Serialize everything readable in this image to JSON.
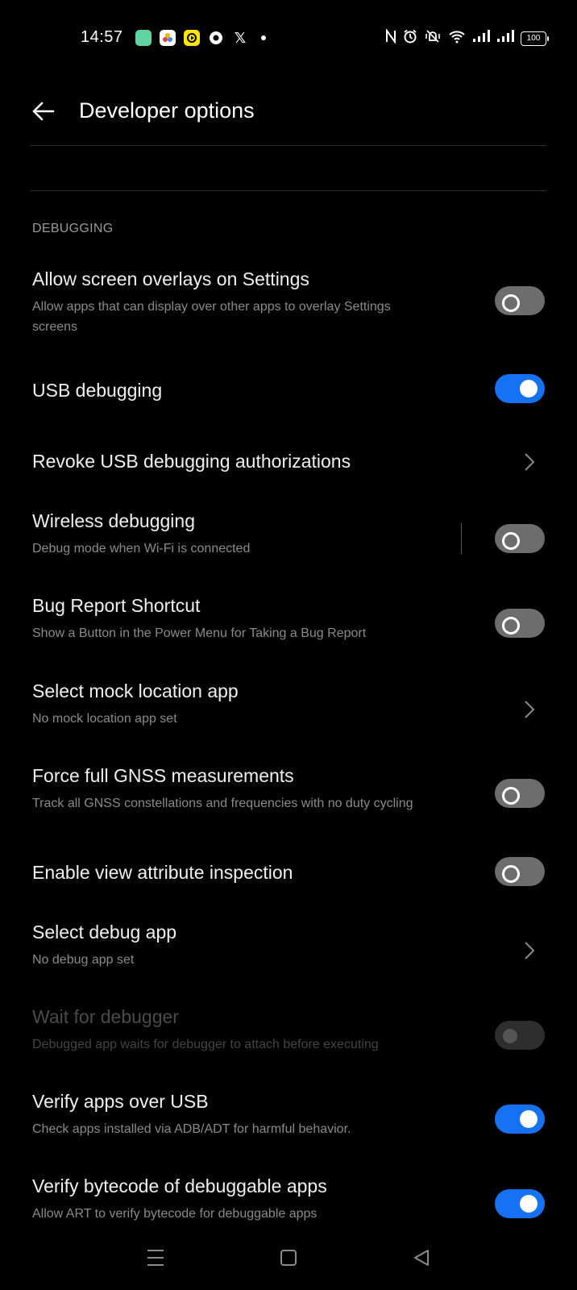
{
  "status_bar": {
    "time": "14:57",
    "battery": "100",
    "app_icons": [
      "messages-icon",
      "photos-icon",
      "snapchat-like-icon",
      "ola-icon",
      "x-icon"
    ],
    "system_icons": [
      "nfc-icon",
      "alarm-icon",
      "vibrate-icon",
      "wifi-icon",
      "signal-icon",
      "signal-icon"
    ]
  },
  "header": {
    "title": "Developer options"
  },
  "section": {
    "label": "DEBUGGING"
  },
  "items": [
    {
      "title": "Allow screen overlays on Settings",
      "subtitle": "Allow apps that can display over other apps to overlay Settings screens",
      "control": "toggle",
      "state": "off"
    },
    {
      "title": "USB debugging",
      "subtitle": "",
      "control": "toggle",
      "state": "on"
    },
    {
      "title": "Revoke USB debugging authorizations",
      "subtitle": "",
      "control": "chevron"
    },
    {
      "title": "Wireless debugging",
      "subtitle": "Debug mode when Wi-Fi is connected",
      "control": "toggle",
      "state": "off"
    },
    {
      "title": "Bug Report Shortcut",
      "subtitle": "Show a Button in the Power Menu for Taking a Bug Report",
      "control": "toggle",
      "state": "off"
    },
    {
      "title": "Select mock location app",
      "subtitle": "No mock location app set",
      "control": "chevron"
    },
    {
      "title": "Force full GNSS measurements",
      "subtitle": "Track all GNSS constellations and frequencies with no duty cycling",
      "control": "toggle",
      "state": "off"
    },
    {
      "title": "Enable view attribute inspection",
      "subtitle": "",
      "control": "toggle",
      "state": "off"
    },
    {
      "title": "Select debug app",
      "subtitle": "No debug app set",
      "control": "chevron"
    },
    {
      "title": "Wait for debugger",
      "subtitle": "Debugged app waits for debugger to attach before executing",
      "control": "toggle",
      "state": "disabled"
    },
    {
      "title": "Verify apps over USB",
      "subtitle": "Check apps installed via ADB/ADT for harmful behavior.",
      "control": "toggle",
      "state": "on"
    },
    {
      "title": "Verify bytecode of debuggable apps",
      "subtitle": "Allow ART to verify bytecode for debuggable apps",
      "control": "toggle",
      "state": "on"
    }
  ],
  "nav_bar": {
    "buttons": [
      "menu-icon",
      "home-icon",
      "back-icon"
    ]
  },
  "colors": {
    "accent": "#1672f3",
    "background": "#000000",
    "toggle_off": "#6d6d6d"
  }
}
